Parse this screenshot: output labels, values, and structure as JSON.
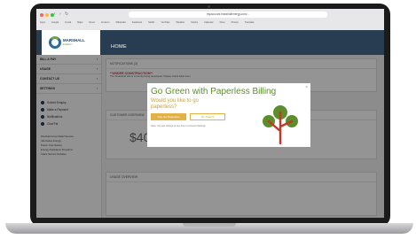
{
  "browser": {
    "url": "myaccount.marshallenergy.com/...",
    "bookmarks": [
      "Apps",
      "Google",
      "Gmail",
      "Maps",
      "News",
      "Amazon",
      "Wikipedia",
      "Facebook",
      "Netflix",
      "YouTube",
      "Weather",
      "Stocks",
      "Calendar",
      "Drive",
      "Photos",
      "Translate"
    ],
    "dot_colors": [
      "#ff5f56",
      "#ffbd2e",
      "#27c93f"
    ]
  },
  "header": {
    "logo_title": "MARSHALL",
    "logo_subtitle": "ENERGY",
    "page": "HOME"
  },
  "sidebar": {
    "items": [
      {
        "label": "BILL & PAY"
      },
      {
        "label": "USAGE"
      },
      {
        "label": "CONTACT US"
      },
      {
        "label": "SETTINGS"
      }
    ],
    "quick_actions": [
      "Submit Enquiry",
      "Make a Payment",
      "Notifications",
      "Chat Pal"
    ],
    "program_links": [
      "Marshall Comp Relief Service",
      "Alternative Energy",
      "Power Cost Saving",
      "Energy Assistance Programs",
      "Share Service Rebates"
    ]
  },
  "main": {
    "notifications_title": "NOTIFICATIONS (3)",
    "notice_title": "**UNDER CONSTRUCTION**",
    "notice_body": "The SmartHub site is currently being developed. Please check back soon.",
    "customer_title": "CUSTOMER OVERVIEW",
    "amount": "$400",
    "usage_title": "USAGE OVERVIEW"
  },
  "modal": {
    "title": "Go Green with Paperless Billing",
    "question": "Would you like to go paperless?",
    "yes_label": "Yes, Go Paperless",
    "no_label": "No Thanks",
    "note": "Note: You can change at any time in Account Settings.",
    "close": "×"
  },
  "colors": {
    "brand_dark": "#283d52",
    "green": "#5c8e2b",
    "gold": "#e2b247",
    "tree_leaf": "#5c8e2b",
    "tree_trunk": "#c0392b"
  }
}
